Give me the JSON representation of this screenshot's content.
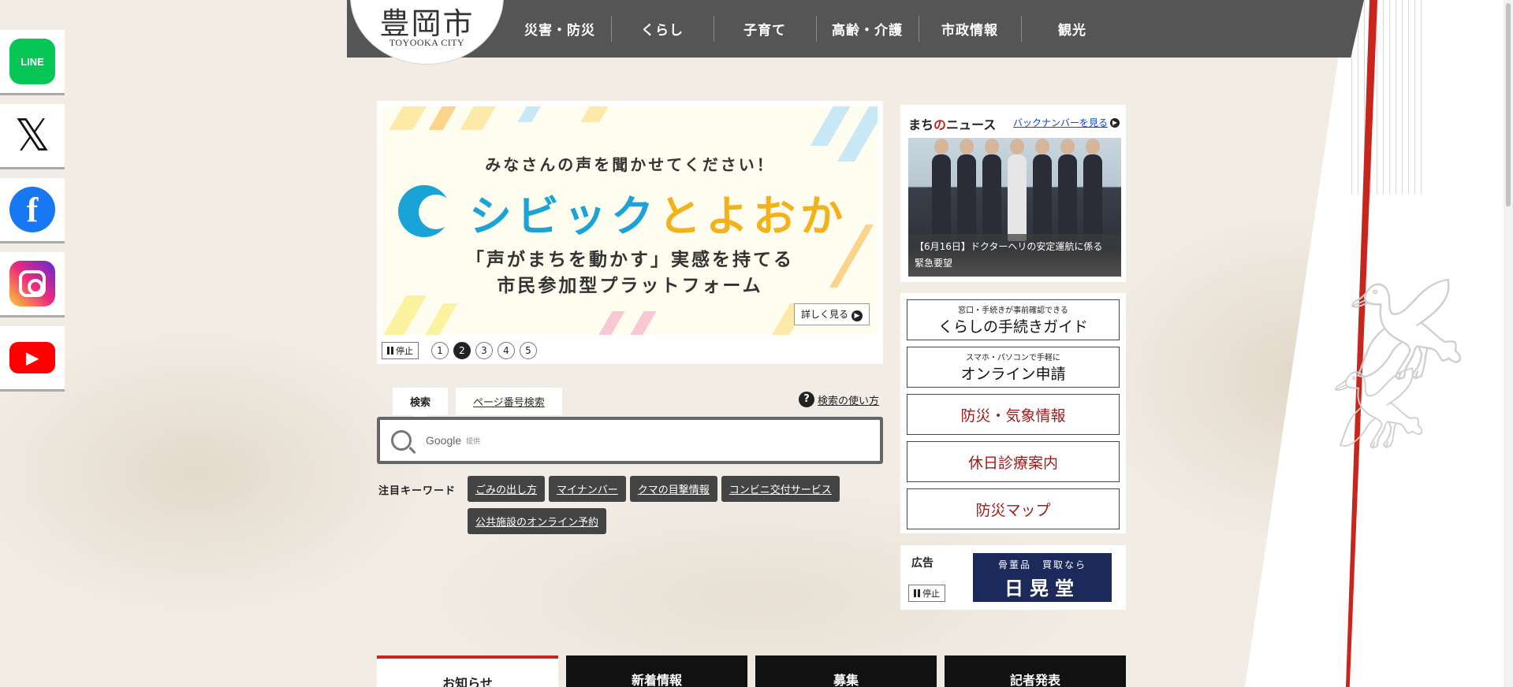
{
  "site": {
    "logo_text": "豊岡市",
    "logo_sub": "TOYOOKA CITY"
  },
  "nav": [
    {
      "label": "災害・防災"
    },
    {
      "label": "くらし"
    },
    {
      "label": "子育て"
    },
    {
      "label": "高齢・介護"
    },
    {
      "label": "市政情報"
    },
    {
      "label": "観光"
    }
  ],
  "social": [
    {
      "name": "LINE",
      "label": "LINE"
    },
    {
      "name": "X",
      "label": "𝕏"
    },
    {
      "name": "Facebook",
      "label": "f"
    },
    {
      "name": "Instagram",
      "label": ""
    },
    {
      "name": "YouTube",
      "label": "▶"
    }
  ],
  "carousel": {
    "tagline": "みなさんの声を聞かせてください！",
    "title_a": "シビック",
    "title_b": "とよおか",
    "sub1": "「声がまちを動かす」実感を持てる",
    "sub2": "市民参加型プラットフォーム",
    "detail_label": "詳しく見る",
    "pause_label": "停止",
    "pages": [
      "1",
      "2",
      "3",
      "4",
      "5"
    ],
    "active_page": 2
  },
  "search": {
    "tab_search": "検索",
    "tab_page": "ページ番号検索",
    "help_label": "検索の使い方",
    "placeholder_google": "Google",
    "placeholder_small": "提供"
  },
  "keywords": {
    "label": "注目キーワード",
    "items": [
      "ごみの出し方",
      "マイナンバー",
      "クマの目撃情報",
      "コンビニ交付サービス",
      "公共施設のオンライン予約"
    ]
  },
  "news": {
    "title_a": "まち",
    "title_no": "の",
    "title_b": "ニュース",
    "back_label": "バックナンバーを見る",
    "caption_1": "【6月16日】ドクターヘリの安定運航に係る",
    "caption_2": "緊急要望"
  },
  "links": [
    {
      "small": "窓口・手続きが事前確認できる",
      "big": "くらしの手続きガイド",
      "red": false
    },
    {
      "small": "スマホ・パソコンで手軽に",
      "big": "オンライン申請",
      "red": false
    },
    {
      "small": "",
      "big": "防災・気象情報",
      "red": true
    },
    {
      "small": "",
      "big": "休日診療案内",
      "red": true
    },
    {
      "small": "",
      "big": "防災マップ",
      "red": true
    }
  ],
  "ad": {
    "label": "広告",
    "pause_label": "停止",
    "banner_small": "骨董品　買取なら",
    "banner_big": "日晃堂"
  },
  "bottom_tabs": [
    {
      "label": "お知らせ",
      "active": true
    },
    {
      "label": "新着情報",
      "active": false
    },
    {
      "label": "募集",
      "active": false
    },
    {
      "label": "記者発表",
      "active": false
    }
  ],
  "colors": {
    "nav_bg": "#555555",
    "accent_red": "#c8261c",
    "brand_blue": "#1aa3d6",
    "brand_yellow": "#f2b21b"
  }
}
